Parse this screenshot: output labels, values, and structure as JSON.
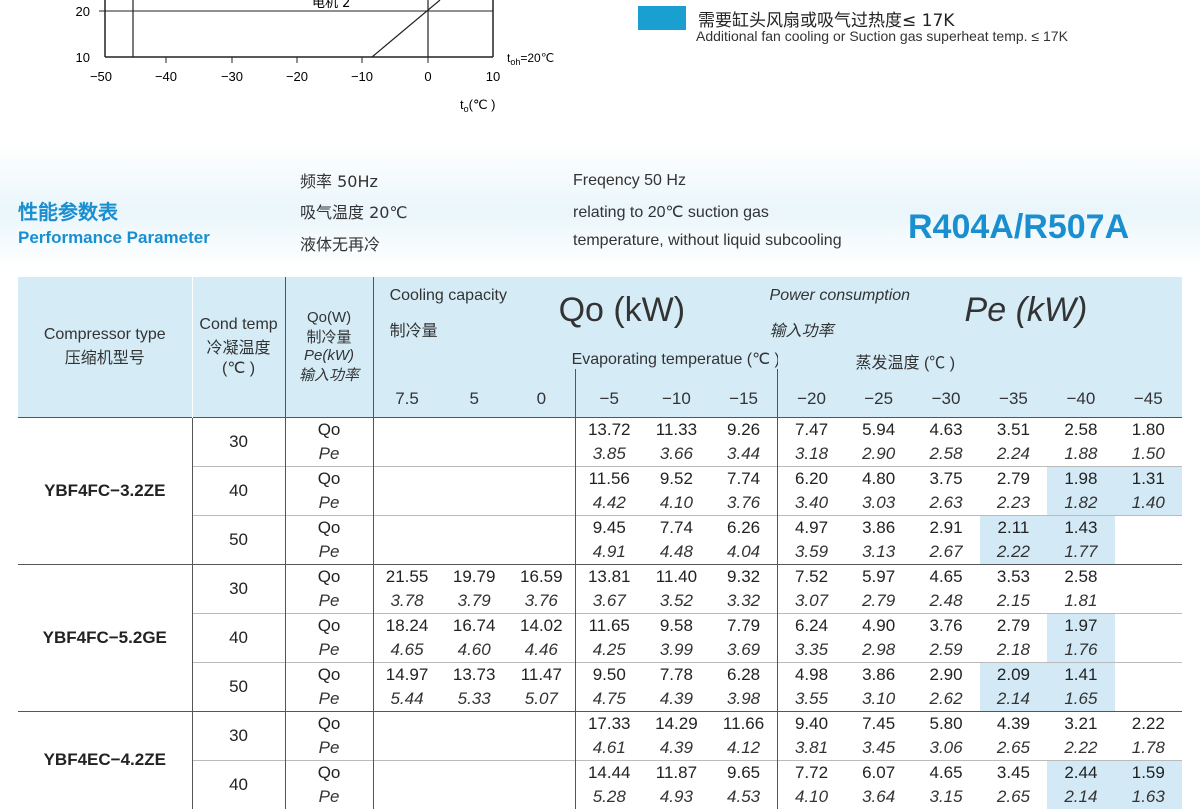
{
  "chart": {
    "y_ticks": [
      "20",
      "10"
    ],
    "x_ticks": [
      "−50",
      "−40",
      "−30",
      "−20",
      "−10",
      "0",
      "10"
    ],
    "motor_label": "电机 2",
    "toh_label": "t",
    "toh_sub": "oh",
    "toh_value": "=20℃",
    "xaxis_label": "t",
    "xaxis_sub": "o",
    "xaxis_unit": "(℃ )"
  },
  "legend": {
    "color": "#1aa0d0",
    "cn": "需要缸头风扇或吸气过热度≤ 17K",
    "en": "Additional fan cooling  or Suction gas superheat temp. ≤ 17K"
  },
  "section": {
    "title_cn": "性能参数表",
    "title_en": "Performance Parameter",
    "cond_cn": [
      "频率 50Hz",
      "吸气温度 20℃",
      "液体无再冷"
    ],
    "cond_en": [
      "Freqency 50 Hz",
      "relating to 20℃ suction gas",
      "temperature, without liquid subcooling"
    ],
    "refrigerant": "R404A/R507A"
  },
  "table": {
    "h_compressor_en": "Compressor type",
    "h_compressor_cn": "压缩机型号",
    "h_cond_en": "Cond temp",
    "h_cond_cn": "冷凝温度",
    "h_cond_unit": "(℃ )",
    "h_qo_w": "Qo(W)",
    "h_qo_cn": "制冷量",
    "h_pe_kw": "Pe(kW)",
    "h_pe_cn": "输入功率",
    "cooling_en": "Cooling capacity",
    "cooling_cn": "制冷量",
    "qo_kw": "Qo (kW)",
    "power_en": "Power consumption",
    "power_cn": "输入功率",
    "pe_kw": "Pe (kW)",
    "evap_en": "Evaporating temperatue (℃ )",
    "evap_cn": "蒸发温度 (℃ )",
    "evap_temps": [
      "7.5",
      "5",
      "0",
      "−5",
      "−10",
      "−15",
      "−20",
      "−25",
      "−30",
      "−35",
      "−40",
      "−45"
    ],
    "qo_label": "Qo",
    "pe_label": "Pe",
    "models": [
      {
        "name": "YBF4FC−3.2ZE",
        "rows": [
          {
            "cond": "30",
            "qo": [
              "",
              "",
              "",
              "13.72",
              "11.33",
              "9.26",
              "7.47",
              "5.94",
              "4.63",
              "3.51",
              "2.58",
              "1.80"
            ],
            "pe": [
              "",
              "",
              "",
              "3.85",
              "3.66",
              "3.44",
              "3.18",
              "2.90",
              "2.58",
              "2.24",
              "1.88",
              "1.50"
            ],
            "hl": []
          },
          {
            "cond": "40",
            "qo": [
              "",
              "",
              "",
              "11.56",
              "9.52",
              "7.74",
              "6.20",
              "4.80",
              "3.75",
              "2.79",
              "1.98",
              "1.31"
            ],
            "pe": [
              "",
              "",
              "",
              "4.42",
              "4.10",
              "3.76",
              "3.40",
              "3.03",
              "2.63",
              "2.23",
              "1.82",
              "1.40"
            ],
            "hl": [
              10,
              11
            ]
          },
          {
            "cond": "50",
            "qo": [
              "",
              "",
              "",
              "9.45",
              "7.74",
              "6.26",
              "4.97",
              "3.86",
              "2.91",
              "2.11",
              "1.43",
              ""
            ],
            "pe": [
              "",
              "",
              "",
              "4.91",
              "4.48",
              "4.04",
              "3.59",
              "3.13",
              "2.67",
              "2.22",
              "1.77",
              ""
            ],
            "hl": [
              9,
              10
            ]
          }
        ]
      },
      {
        "name": "YBF4FC−5.2GE",
        "rows": [
          {
            "cond": "30",
            "qo": [
              "21.55",
              "19.79",
              "16.59",
              "13.81",
              "11.40",
              "9.32",
              "7.52",
              "5.97",
              "4.65",
              "3.53",
              "2.58",
              ""
            ],
            "pe": [
              "3.78",
              "3.79",
              "3.76",
              "3.67",
              "3.52",
              "3.32",
              "3.07",
              "2.79",
              "2.48",
              "2.15",
              "1.81",
              ""
            ],
            "hl": []
          },
          {
            "cond": "40",
            "qo": [
              "18.24",
              "16.74",
              "14.02",
              "11.65",
              "9.58",
              "7.79",
              "6.24",
              "4.90",
              "3.76",
              "2.79",
              "1.97",
              ""
            ],
            "pe": [
              "4.65",
              "4.60",
              "4.46",
              "4.25",
              "3.99",
              "3.69",
              "3.35",
              "2.98",
              "2.59",
              "2.18",
              "1.76",
              ""
            ],
            "hl": [
              10
            ]
          },
          {
            "cond": "50",
            "qo": [
              "14.97",
              "13.73",
              "11.47",
              "9.50",
              "7.78",
              "6.28",
              "4.98",
              "3.86",
              "2.90",
              "2.09",
              "1.41",
              ""
            ],
            "pe": [
              "5.44",
              "5.33",
              "5.07",
              "4.75",
              "4.39",
              "3.98",
              "3.55",
              "3.10",
              "2.62",
              "2.14",
              "1.65",
              ""
            ],
            "hl": [
              9,
              10
            ]
          }
        ]
      },
      {
        "name": "YBF4EC−4.2ZE",
        "rows": [
          {
            "cond": "30",
            "qo": [
              "",
              "",
              "",
              "17.33",
              "14.29",
              "11.66",
              "9.40",
              "7.45",
              "5.80",
              "4.39",
              "3.21",
              "2.22"
            ],
            "pe": [
              "",
              "",
              "",
              "4.61",
              "4.39",
              "4.12",
              "3.81",
              "3.45",
              "3.06",
              "2.65",
              "2.22",
              "1.78"
            ],
            "hl": []
          },
          {
            "cond": "40",
            "qo": [
              "",
              "",
              "",
              "14.44",
              "11.87",
              "9.65",
              "7.72",
              "6.07",
              "4.65",
              "3.45",
              "2.44",
              "1.59"
            ],
            "pe": [
              "",
              "",
              "",
              "5.28",
              "4.93",
              "4.53",
              "4.10",
              "3.64",
              "3.15",
              "2.65",
              "2.14",
              "1.63"
            ],
            "hl": [
              10,
              11
            ]
          }
        ]
      }
    ]
  }
}
